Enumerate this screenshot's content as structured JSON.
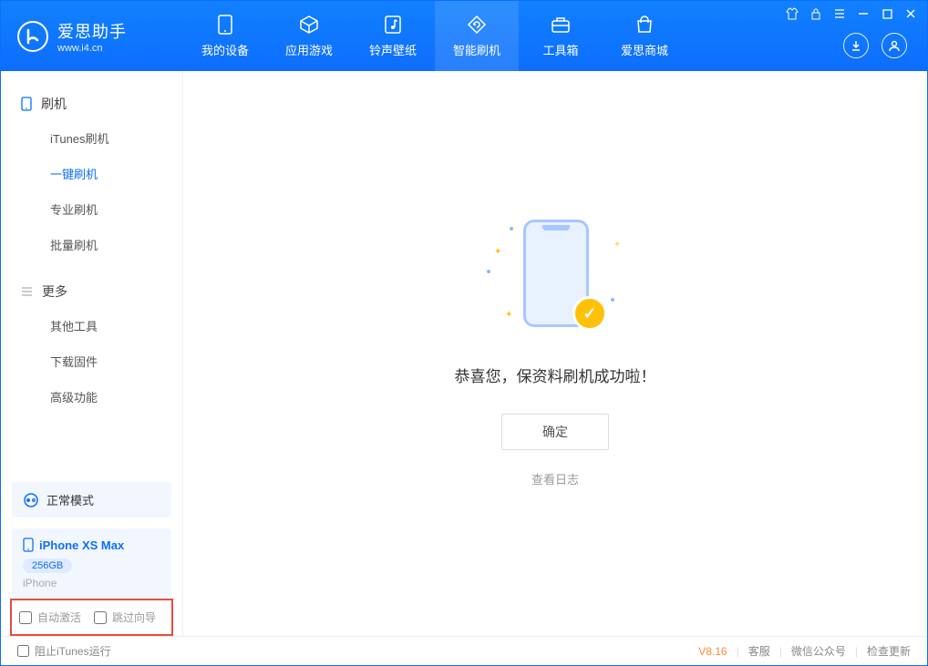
{
  "header": {
    "app_title": "爱思助手",
    "app_url": "www.i4.cn",
    "tabs": [
      {
        "label": "我的设备",
        "icon": "device"
      },
      {
        "label": "应用游戏",
        "icon": "cube"
      },
      {
        "label": "铃声壁纸",
        "icon": "music"
      },
      {
        "label": "智能刷机",
        "icon": "refresh",
        "active": true
      },
      {
        "label": "工具箱",
        "icon": "toolbox"
      },
      {
        "label": "爱思商城",
        "icon": "store"
      }
    ]
  },
  "sidebar": {
    "section1_title": "刷机",
    "section1_items": [
      {
        "label": "iTunes刷机"
      },
      {
        "label": "一键刷机",
        "active": true
      },
      {
        "label": "专业刷机"
      },
      {
        "label": "批量刷机"
      }
    ],
    "section2_title": "更多",
    "section2_items": [
      {
        "label": "其他工具"
      },
      {
        "label": "下载固件"
      },
      {
        "label": "高级功能"
      }
    ],
    "mode_label": "正常模式",
    "device": {
      "name": "iPhone XS Max",
      "capacity": "256GB",
      "type": "iPhone"
    },
    "opt_auto_activate": "自动激活",
    "opt_skip_guide": "跳过向导"
  },
  "main": {
    "success_text": "恭喜您，保资料刷机成功啦！",
    "ok_button": "确定",
    "view_log": "查看日志"
  },
  "footer": {
    "block_itunes": "阻止iTunes运行",
    "version": "V8.16",
    "support": "客服",
    "wechat": "微信公众号",
    "check_update": "检查更新"
  }
}
